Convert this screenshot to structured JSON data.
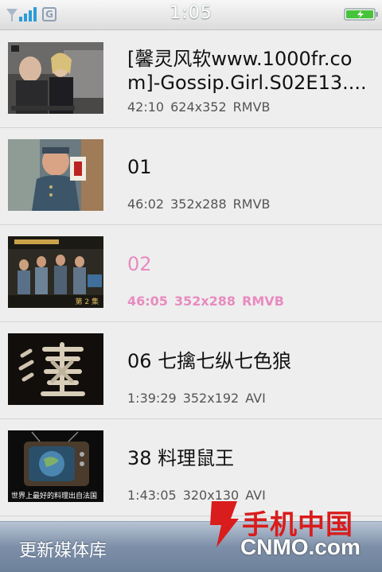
{
  "status_bar": {
    "time": "1:05",
    "network_icon": "signal-bars-icon",
    "g_label": "G",
    "battery_icon": "battery-charging-icon"
  },
  "media_items": [
    {
      "title": "[馨灵风软www.1000fr.com]-Gossip.Girl.S02E13....",
      "duration": "42:10",
      "resolution": "624x352",
      "format": "RMVB",
      "thumb_caption": "",
      "thumb_icon": "video-thumbnail"
    },
    {
      "title": "01",
      "duration": "46:02",
      "resolution": "352x288",
      "format": "RMVB",
      "thumb_caption": "",
      "thumb_icon": "video-thumbnail"
    },
    {
      "title": "02",
      "duration": "46:05",
      "resolution": "352x288",
      "format": "RMVB",
      "active": true,
      "thumb_caption": "第 2 集",
      "thumb_icon": "video-thumbnail"
    },
    {
      "title": "06 七擒七纵七色狼",
      "duration": "1:39:29",
      "resolution": "352x192",
      "format": "AVI",
      "thumb_caption": "",
      "thumb_icon": "video-thumbnail"
    },
    {
      "title": "38 料理鼠王",
      "duration": "1:43:05",
      "resolution": "320x130",
      "format": "AVI",
      "thumb_caption": "世界上最好的料理出自法国",
      "thumb_icon": "video-thumbnail"
    }
  ],
  "bottom_bar": {
    "update_label": "更新媒体库"
  },
  "watermark": {
    "brand": "手机中国",
    "domain": "CNMO.com"
  },
  "colors": {
    "active_text": "#e88bbf",
    "bottom_bar": "#7d8fa8",
    "watermark_red": "#d91c1c"
  }
}
